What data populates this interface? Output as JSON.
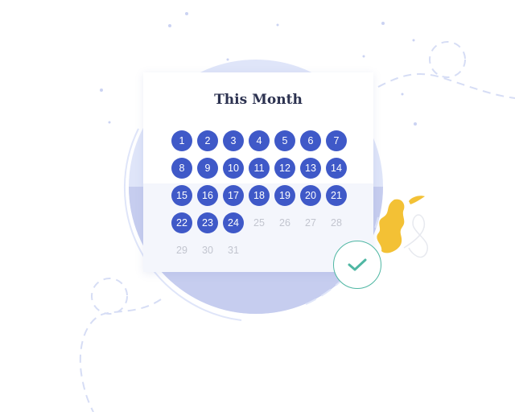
{
  "calendar": {
    "title": "This Month",
    "completed_through": 24,
    "days": [
      "1",
      "2",
      "3",
      "4",
      "5",
      "6",
      "7",
      "8",
      "9",
      "10",
      "11",
      "12",
      "13",
      "14",
      "15",
      "16",
      "17",
      "18",
      "19",
      "20",
      "21",
      "22",
      "23",
      "24",
      "25",
      "26",
      "27",
      "28",
      "29",
      "30",
      "31"
    ]
  },
  "colors": {
    "accent": "#3f59c8",
    "circle_light": "#dfe5f9",
    "circle_dark": "#c6cdef",
    "check": "#4fb7a3",
    "leaf": "#f3c135",
    "muted_text": "#c2c5cf",
    "title_text": "#2c3250"
  },
  "icons": {
    "check": "check-icon",
    "leaf": "leaf-decoration"
  }
}
